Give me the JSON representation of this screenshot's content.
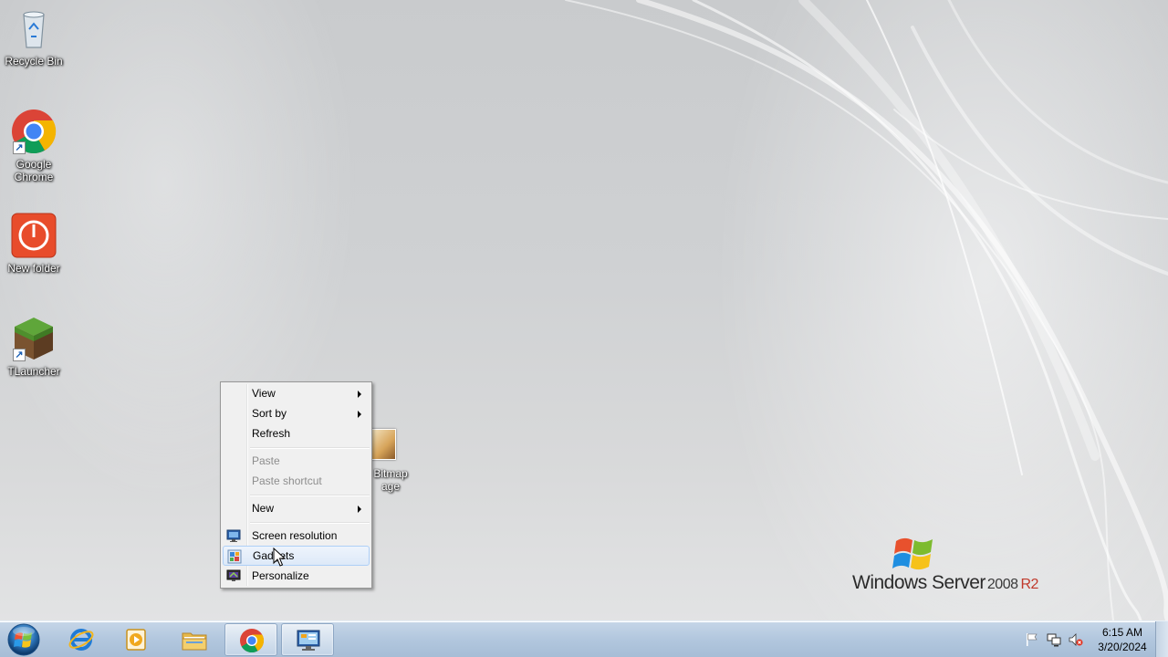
{
  "desktop": {
    "icons": [
      {
        "label": "Recycle Bin"
      },
      {
        "label": "Google Chrome"
      },
      {
        "label": "New folder"
      },
      {
        "label": "TLauncher"
      }
    ],
    "partial_icon": {
      "label": "Bitmap\nage"
    }
  },
  "context_menu": {
    "items": [
      {
        "label": "View",
        "submenu": true,
        "enabled": true
      },
      {
        "label": "Sort by",
        "submenu": true,
        "enabled": true
      },
      {
        "label": "Refresh",
        "enabled": true
      },
      {
        "label": "Paste",
        "enabled": false
      },
      {
        "label": "Paste shortcut",
        "enabled": false
      },
      {
        "label": "New",
        "submenu": true,
        "enabled": true
      },
      {
        "label": "Screen resolution",
        "enabled": true,
        "icon": "monitor-icon"
      },
      {
        "label": "Gadgets",
        "enabled": true,
        "icon": "gadgets-icon",
        "highlighted": true
      },
      {
        "label": "Personalize",
        "enabled": true,
        "icon": "personalize-icon"
      }
    ]
  },
  "branding": {
    "name": "Windows Server",
    "version": "2008",
    "release": "R2"
  },
  "taskbar": {
    "buttons": [
      {
        "icon": "internet-explorer-icon"
      },
      {
        "icon": "media-player-icon"
      },
      {
        "icon": "file-explorer-icon"
      },
      {
        "icon": "chrome-icon"
      },
      {
        "icon": "control-panel-icon"
      }
    ],
    "tray_icons": [
      "action-center-flag-icon",
      "network-icon",
      "volume-muted-icon"
    ],
    "time": "6:15 AM",
    "date": "3/20/2024"
  }
}
